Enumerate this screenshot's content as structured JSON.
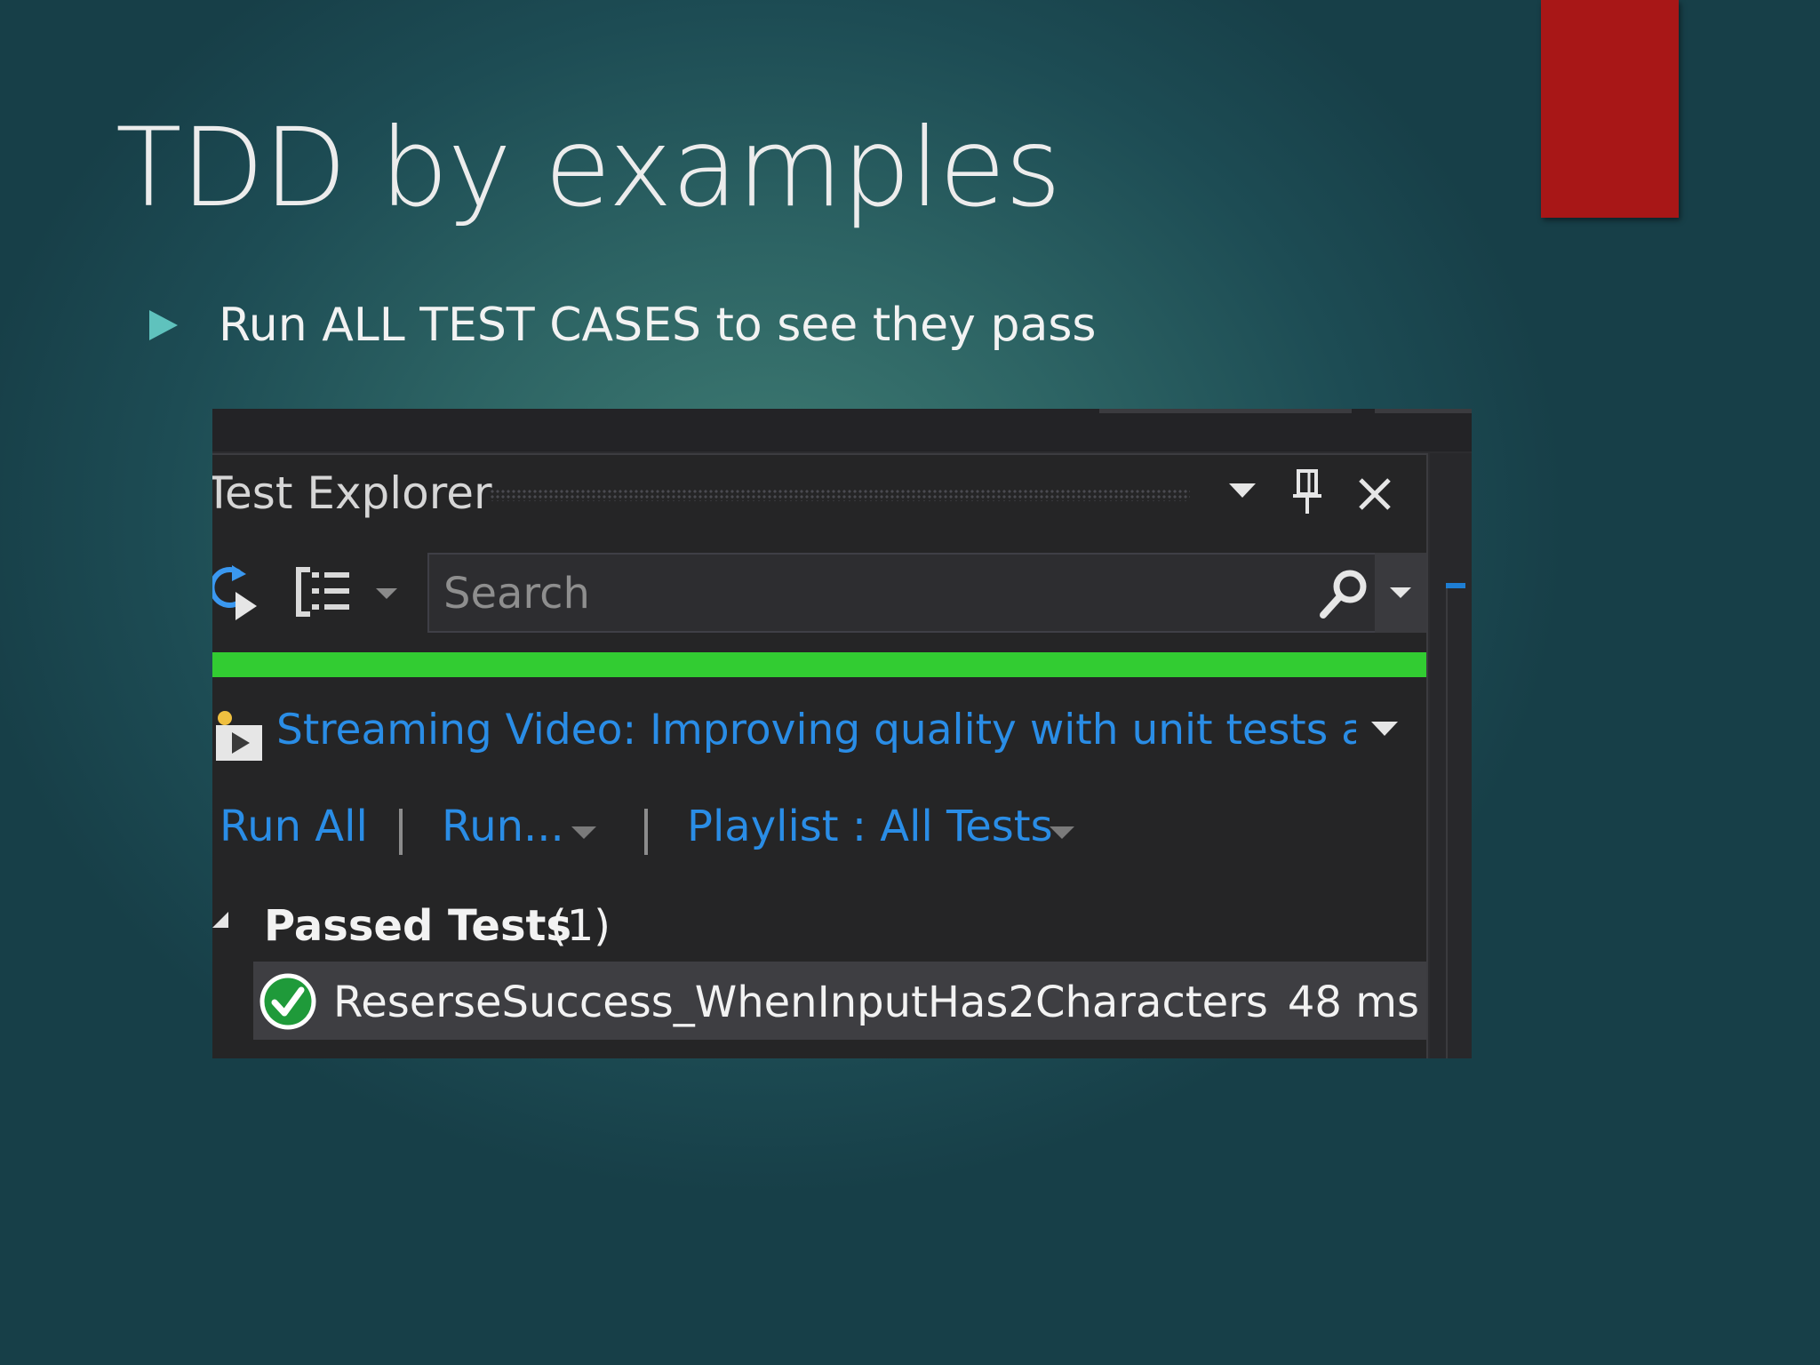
{
  "slide": {
    "title": "TDD by examples",
    "bullet": "Run ALL TEST CASES to see they pass",
    "accent_color": "#a81717"
  },
  "test_explorer": {
    "title": "Test Explorer",
    "icons": {
      "dropdown": "chevron-down-icon",
      "pin": "pin-icon",
      "close": "close-icon",
      "run_refresh": "run-refresh-icon",
      "group_by": "group-by-icon",
      "search": "search-icon"
    },
    "search": {
      "value": "",
      "placeholder": "Search"
    },
    "progress": {
      "value": 1.0,
      "color": "#32cc32"
    },
    "video_link": "Streaming Video: Improving quality with unit tests ar",
    "commands": {
      "run_all": "Run All",
      "run": "Run...",
      "playlist": "Playlist : All Tests"
    },
    "group": {
      "label": "Passed Tests",
      "count": "(1)"
    },
    "tests": [
      {
        "name": "ReserseSuccess_WhenInputHas2Characters",
        "duration": "48 ms",
        "status": "passed"
      }
    ],
    "colors": {
      "link": "#2a8de6",
      "pass": "#1f9a3a"
    }
  }
}
